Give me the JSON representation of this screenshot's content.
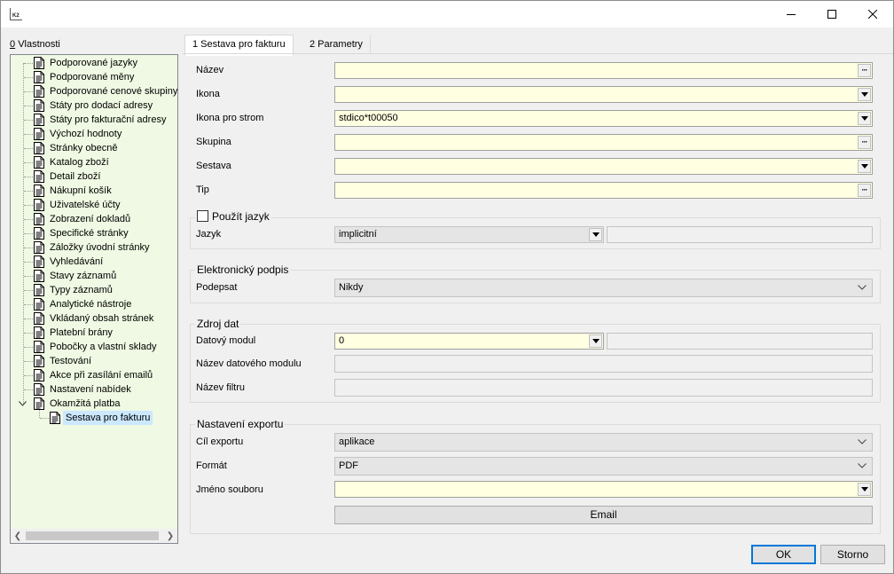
{
  "window": {
    "app_icon": "k2-app-icon",
    "controls": [
      "minimize-icon",
      "maximize-icon",
      "close-icon"
    ]
  },
  "properties_label": {
    "hotkey": "0",
    "text": "Vlastnosti"
  },
  "tree": {
    "items": [
      "Podporované jazyky",
      "Podporované měny",
      "Podporované cenové skupiny",
      "Státy pro dodací adresy",
      "Státy pro fakturační adresy",
      "Výchozí hodnoty",
      "Stránky obecně",
      "Katalog zboží",
      "Detail zboží",
      "Nákupní košík",
      "Uživatelské účty",
      "Zobrazení dokladů",
      "Specifické stránky",
      "Záložky úvodní stránky",
      "Vyhledávání",
      "Stavy záznamů",
      "Typy záznamů",
      "Analytické nástroje",
      "Vkládaný obsah stránek",
      "Platební brány",
      "Pobočky a vlastní sklady",
      "Testování",
      "Akce při zasílání emailů",
      "Nastavení nabídek",
      "Okamžitá platba"
    ],
    "child": "Sestava pro fakturu"
  },
  "tabs": [
    {
      "label": "1 Sestava pro fakturu",
      "active": true
    },
    {
      "label": "2 Parametry",
      "active": false
    }
  ],
  "fields": {
    "nazev": {
      "label": "Název",
      "value": ""
    },
    "ikona": {
      "label": "Ikona",
      "value": ""
    },
    "ikona_strom": {
      "label": "Ikona pro strom",
      "value": "stdico*t00050"
    },
    "skupina": {
      "label": "Skupina",
      "value": ""
    },
    "sestava": {
      "label": "Sestava",
      "value": ""
    },
    "tip": {
      "label": "Tip",
      "value": ""
    }
  },
  "lang_group": {
    "checkbox_label": "Použít jazyk",
    "checked": false,
    "jazyk_label": "Jazyk",
    "jazyk_value": "implicitní",
    "jazyk_extra": ""
  },
  "sign_group": {
    "title": "Elektronický podpis",
    "podepsat_label": "Podepsat",
    "podepsat_value": "Nikdy"
  },
  "data_group": {
    "title": "Zdroj dat",
    "modul_label": "Datový modul",
    "modul_value": "0",
    "modul_extra": "",
    "modul_name_label": "Název datového modulu",
    "modul_name_value": "",
    "filter_label": "Název filtru",
    "filter_value": ""
  },
  "export_group": {
    "title": "Nastavení exportu",
    "target_label": "Cíl exportu",
    "target_value": "aplikace",
    "format_label": "Formát",
    "format_value": "PDF",
    "filename_label": "Jméno souboru",
    "filename_value": "",
    "email_button": "Email"
  },
  "buttons": {
    "ok": "OK",
    "cancel": "Storno"
  },
  "colors": {
    "field_bg": "#ffffe1",
    "tree_bg": "#eff9e3",
    "selection": "#cce8ff",
    "focus": "#0078d7"
  }
}
